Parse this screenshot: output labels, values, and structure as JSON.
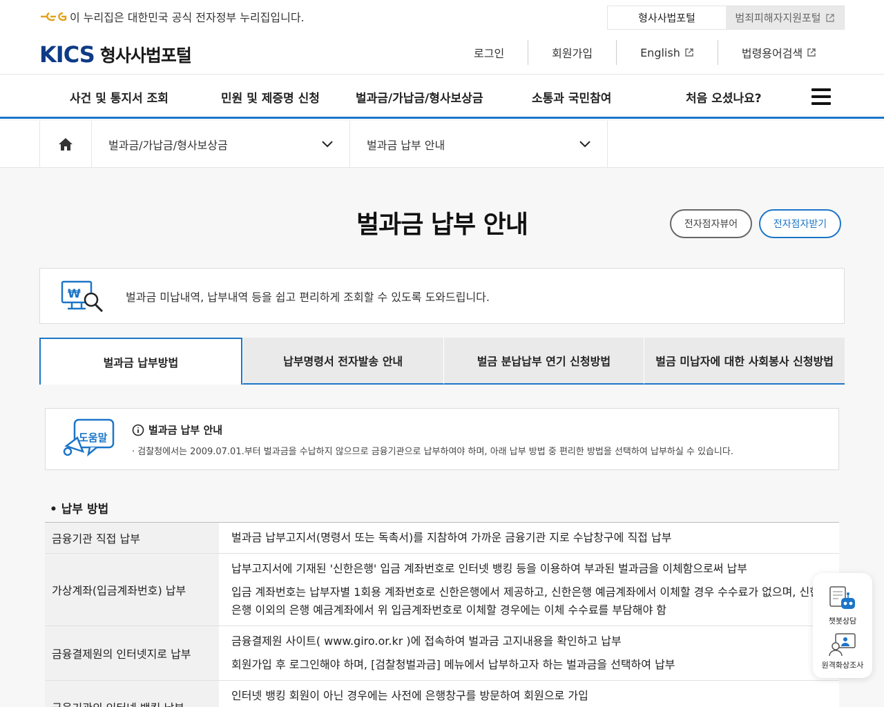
{
  "gov_bar": {
    "notice": "이 누리집은 대한민국 공식 전자정부 누리집입니다.",
    "portals": [
      {
        "label": "형사사법포털",
        "active": true
      },
      {
        "label": "범죄피해자지원포털",
        "active": false,
        "external": true
      }
    ]
  },
  "header": {
    "logo_mark": "KICS",
    "logo_text": "형사사법포털",
    "util_links": [
      {
        "label": "로그인"
      },
      {
        "label": "회원가입"
      },
      {
        "label": "English",
        "external": true
      },
      {
        "label": "법령용어검색",
        "external": true
      }
    ]
  },
  "gnb": {
    "items": [
      {
        "label": "사건 및 통지서 조회"
      },
      {
        "label": "민원 및 제증명 신청"
      },
      {
        "label": "벌과금/가납금/형사보상금"
      },
      {
        "label": "소통과 국민참여"
      },
      {
        "label": "처음 오셨나요?"
      }
    ],
    "menu_icon": "hamburger-icon"
  },
  "breadcrumb": {
    "home_icon": "home-icon",
    "level1": "벌과금/가납금/형사보상금",
    "level2": "벌과금 납부 안내"
  },
  "page": {
    "title": "벌과금 납부 안내",
    "buttons": {
      "viewer": "전자점자뷰어",
      "download": "전자점자받기"
    }
  },
  "intro": {
    "icon": "won-search-icon",
    "text": "벌과금 미납내역, 납부내역 등을 쉽고 편리하게 조회할 수 있도록 도와드립니다."
  },
  "tabs": [
    {
      "label": "벌과금 납부방법",
      "active": true
    },
    {
      "label": "납부명령서 전자발송 안내",
      "active": false
    },
    {
      "label": "벌금 분납납부 연기 신청방법",
      "active": false
    },
    {
      "label": "벌금 미납자에 대한 사회봉사 신청방법",
      "active": false
    }
  ],
  "help": {
    "badge": "도움말",
    "title": "벌과금 납부 안내",
    "desc": "· 검찰청에서는 2009.07.01.부터 벌과금을 수납하지 않으므로 금융기관으로 납부하여야 하며, 아래 납부 방법 중 편리한 방법을 선택하여 납부하실 수 있습니다."
  },
  "section": {
    "title": "• 납부 방법"
  },
  "payment_methods": [
    {
      "method": "금융기관 직접 납부",
      "lines": [
        "벌과금 납부고지서(명령서 또는 독촉서)를 지참하여 가까운 금융기관 지로 수납창구에 직접 납부"
      ]
    },
    {
      "method": "가상계좌(입금계좌번호) 납부",
      "lines": [
        "납부고지서에 기재된 '신한은행' 입금 계좌번호로 인터넷 뱅킹 등을 이용하여 부과된 벌과금을 이체함으로써 납부",
        "입금 계좌번호는 납부자별 1회용 계좌번호로 신한은행에서 제공하고, 신한은행 예금계좌에서 이체할 경우 수수료가 없으며, 신한은행 이외의 은행 예금계좌에서 위 입금계좌번호로 이체할 경우에는 이체 수수료를 부담해야 함"
      ]
    },
    {
      "method": "금융결제원의 인터넷지로 납부",
      "lines": [
        "금융결제원 사이트( www.giro.or.kr )에 접속하여 벌과금 고지내용을 확인하고 납부",
        "회원가입 후 로그인해야 하며, [검찰청벌과금] 메뉴에서 납부하고자 하는 벌과금을 선택하여 납부"
      ]
    },
    {
      "method": "금융기관의 인터넷 뱅킹 납부",
      "lines": [
        "인터넷 뱅킹 회원이 아닌 경우에는 사전에 은행창구를 방문하여 회원으로 가입"
      ]
    }
  ],
  "floating": {
    "chatbot": "챗봇상담",
    "video": "원격화상조사"
  },
  "colors": {
    "accent": "#1b75c8",
    "logo": "#0f3b86",
    "gov_logo": "#e2a21a"
  }
}
